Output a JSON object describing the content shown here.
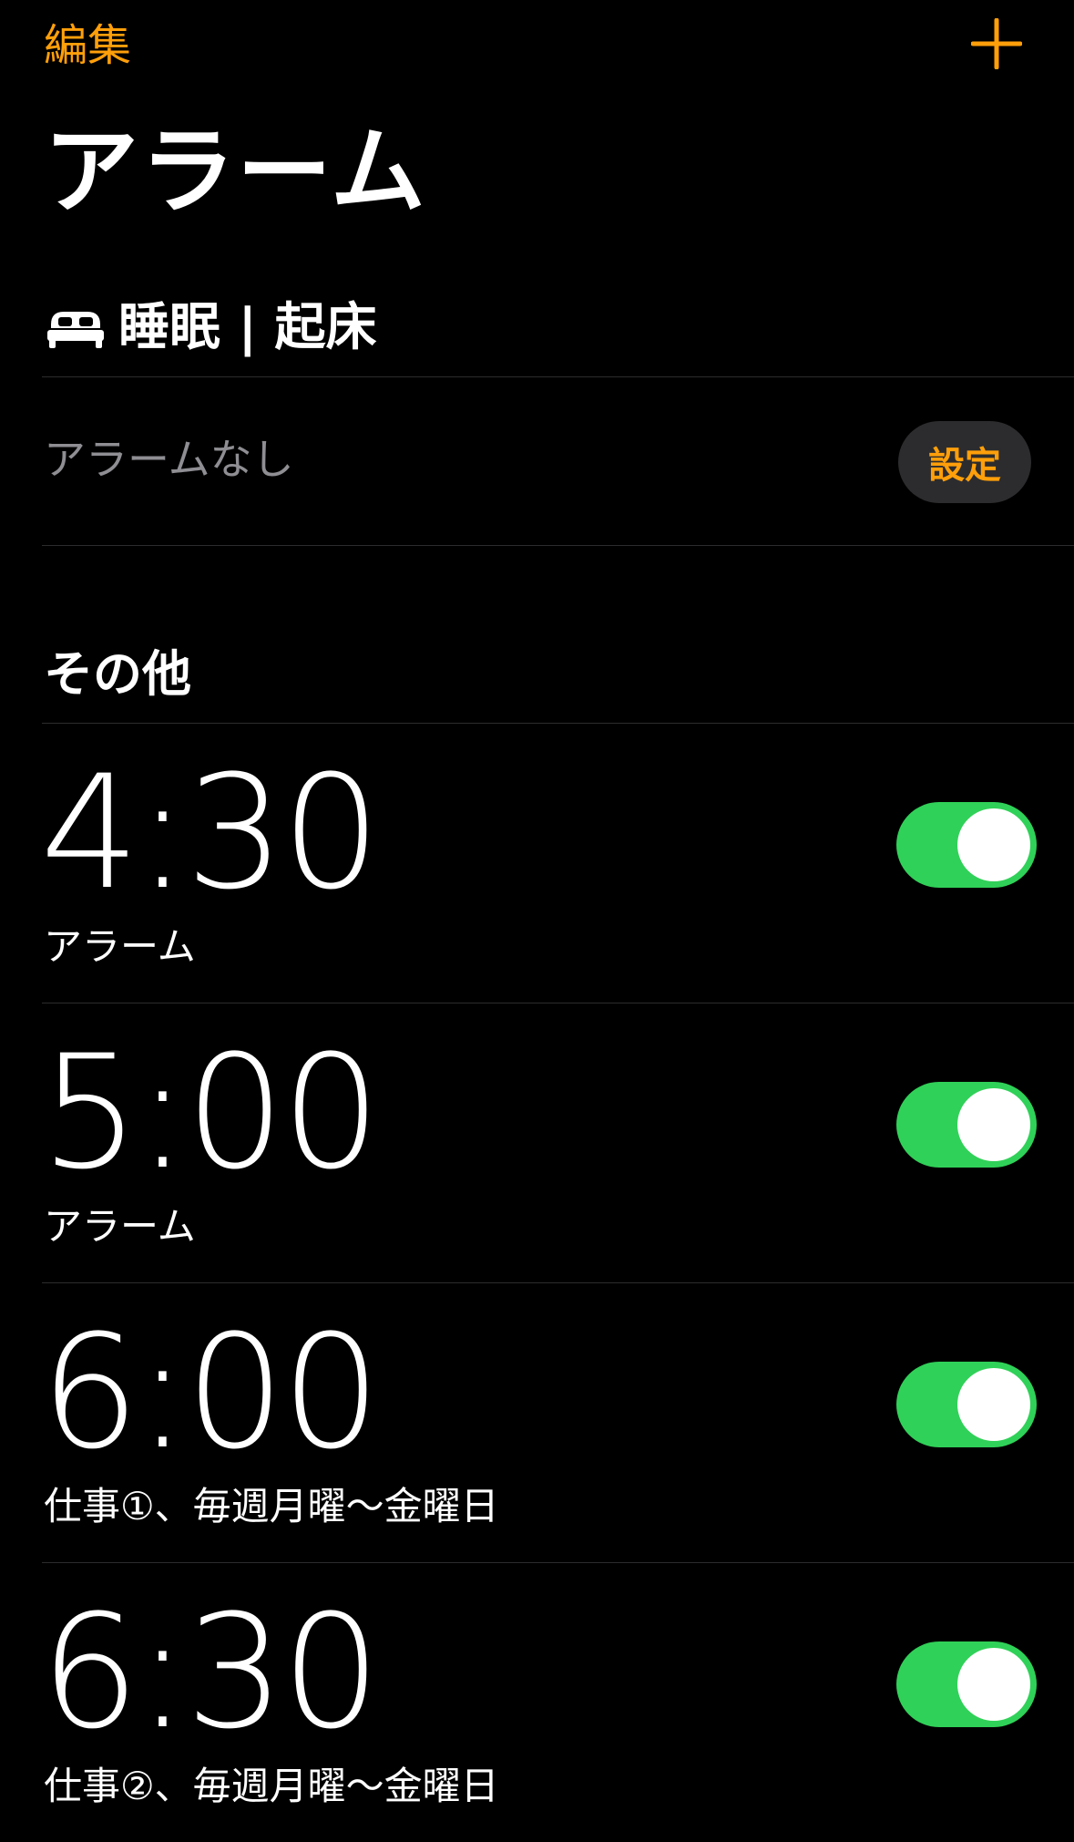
{
  "colors": {
    "accent": "#ff9f0a",
    "toggle_on": "#30d158",
    "secondary_text": "#8e8e93",
    "button_bg": "#2c2c2e"
  },
  "nav": {
    "edit_label": "編集",
    "add_icon": "plus-icon"
  },
  "page_title": "アラーム",
  "sleep": {
    "icon": "bed-icon",
    "title": "睡眠 | 起床",
    "no_alarm_text": "アラームなし",
    "set_label": "設定"
  },
  "other": {
    "title": "その他"
  },
  "alarms": [
    {
      "time": "4:30",
      "label": "アラーム",
      "enabled": true
    },
    {
      "time": "5:00",
      "label": "アラーム",
      "enabled": true
    },
    {
      "time": "6:00",
      "label": "仕事①、毎週月曜〜金曜日",
      "enabled": true
    },
    {
      "time": "6:30",
      "label": "仕事②、毎週月曜〜金曜日",
      "enabled": true
    }
  ]
}
